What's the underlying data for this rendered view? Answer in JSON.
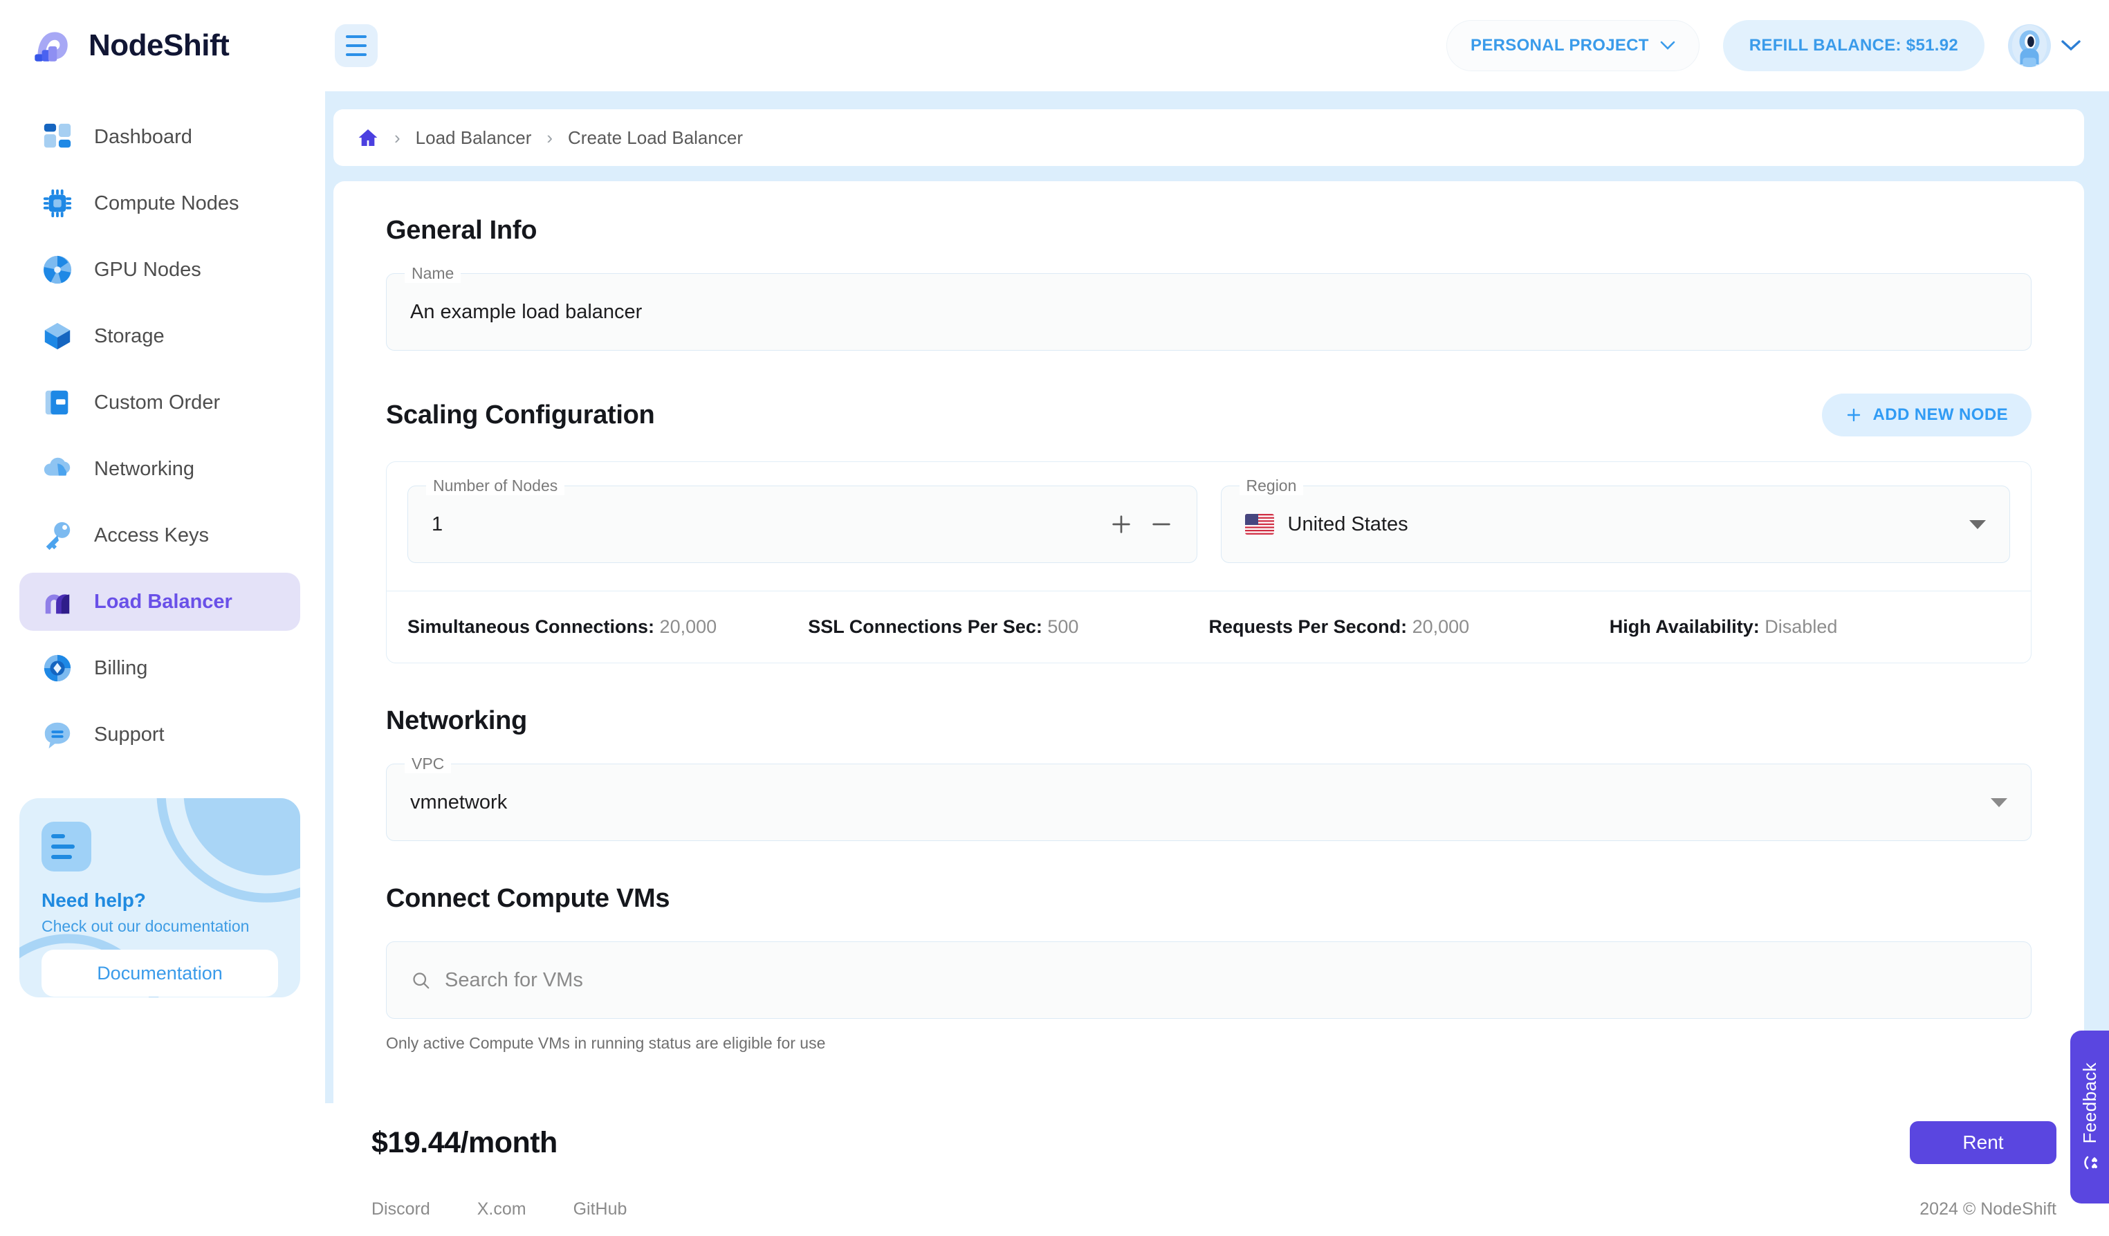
{
  "brand": {
    "name": "NodeShift"
  },
  "topbar": {
    "menu_icon": "hamburger-icon",
    "project_label": "PERSONAL PROJECT",
    "refill_label": "REFILL BALANCE:  $51.92"
  },
  "sidebar": {
    "items": [
      {
        "label": "Dashboard",
        "icon": "dashboard-icon",
        "active": false
      },
      {
        "label": "Compute Nodes",
        "icon": "cpu-chip-icon",
        "active": false
      },
      {
        "label": "GPU Nodes",
        "icon": "gpu-fan-icon",
        "active": false
      },
      {
        "label": "Storage",
        "icon": "cube-icon",
        "active": false
      },
      {
        "label": "Custom Order",
        "icon": "document-icon",
        "active": false
      },
      {
        "label": "Networking",
        "icon": "cloud-icon",
        "active": false
      },
      {
        "label": "Access Keys",
        "icon": "key-icon",
        "active": false
      },
      {
        "label": "Load Balancer",
        "icon": "load-balancer-icon",
        "active": true
      },
      {
        "label": "Billing",
        "icon": "billing-diamond-icon",
        "active": false
      },
      {
        "label": "Support",
        "icon": "chat-bubble-icon",
        "active": false
      }
    ],
    "help_card": {
      "icon": "document-lines-icon",
      "title": "Need help?",
      "subtitle": "Check out our documentation",
      "button_label": "Documentation"
    }
  },
  "breadcrumb": {
    "home_icon": "home-icon",
    "items": [
      "Load Balancer",
      "Create Load Balancer"
    ],
    "separator": "›"
  },
  "main": {
    "general_info": {
      "heading": "General Info",
      "name_label": "Name",
      "name_value": "An example load balancer"
    },
    "scaling": {
      "heading": "Scaling Configuration",
      "add_node_label": "ADD NEW NODE",
      "add_node_icon": "plus-icon",
      "nodes_label": "Number of Nodes",
      "nodes_value": "1",
      "increment_icon": "plus-icon",
      "decrement_icon": "minus-icon",
      "region_label": "Region",
      "region_value": "United States",
      "region_flag": "us-flag-icon",
      "stats": [
        {
          "label": "Simultaneous Connections:",
          "value": "20,000"
        },
        {
          "label": "SSL Connections Per Sec:",
          "value": "500"
        },
        {
          "label": "Requests Per Second:",
          "value": "20,000"
        },
        {
          "label": "High Availability:",
          "value": "Disabled"
        }
      ]
    },
    "networking": {
      "heading": "Networking",
      "vpc_label": "VPC",
      "vpc_value": "vmnetwork"
    },
    "connect_vms": {
      "heading": "Connect Compute VMs",
      "search_icon": "search-icon",
      "search_placeholder": "Search for VMs",
      "search_value": "",
      "hint": "Only active Compute VMs in running status are eligible for use"
    }
  },
  "footer": {
    "price": "$19.44/month",
    "rent_label": "Rent",
    "links": [
      "Discord",
      "X.com",
      "GitHub"
    ],
    "copyright": "2024 © NodeShift"
  },
  "feedback": {
    "label": "Feedback",
    "icon": "smiley-icon"
  },
  "colors": {
    "accent_blue": "#3a9bea",
    "accent_purple": "#5a46e0",
    "sidebar_active_bg": "#e4e2f8",
    "page_bg": "#dceefc"
  }
}
